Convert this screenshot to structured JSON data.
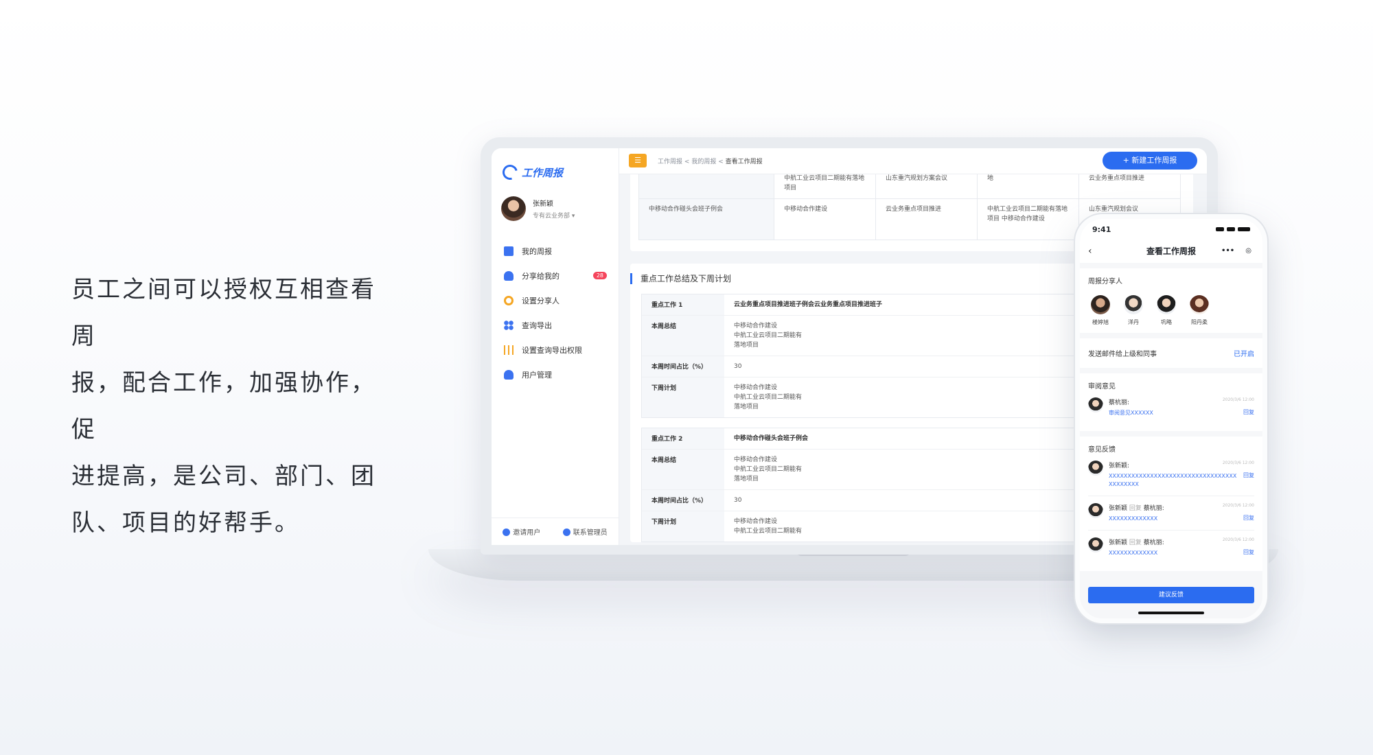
{
  "tagline": [
    "员工之间可以授权互相查看周",
    "报，配合工作，加强协作，促",
    "进提高，是公司、部门、团",
    "队、项目的好帮手。"
  ],
  "app": {
    "logo_text": "工作周报",
    "user": {
      "name": "张新颖",
      "dept": "专有云业务部 ▾"
    },
    "nav": [
      {
        "label": "我的周报",
        "icon": "book-icon"
      },
      {
        "label": "分享给我的",
        "icon": "share-icon",
        "badge": "28"
      },
      {
        "label": "设置分享人",
        "icon": "gear-icon"
      },
      {
        "label": "查询导出",
        "icon": "grid-icon"
      },
      {
        "label": "设置查询导出权限",
        "icon": "sliders-icon"
      },
      {
        "label": "用户管理",
        "icon": "user-icon"
      }
    ],
    "footer": {
      "invite": "邀请用户",
      "contact": "联系管理员"
    },
    "breadcrumb": {
      "a": "工作周报",
      "b": "我的周报",
      "current": "查看工作周报",
      "sep": "<"
    },
    "new_button": "+ 新建工作周报",
    "upper_table": [
      [
        "",
        "中航工业云项目二期能有落地项目",
        "山东重汽规划方案会议",
        "地",
        "云业务重点项目推进"
      ],
      [
        "中移动合作碰头会班子例会",
        "中移动合作建设",
        "云业务重点项目推进",
        "中航工业云项目二期能有落地项目 中移动合作建设",
        "山东重汽规划会议"
      ]
    ],
    "section_title": "重点工作总结及下周计划",
    "works": [
      {
        "title_label": "重点工作 1",
        "title": "云业务重点项目推进班子例会云业务重点项目推进班子",
        "summary_label": "本周总结",
        "summary": "中移动合作建设\n中航工业云项目二期能有\n落地项目",
        "ratio_label": "本周时间占比（%）",
        "ratio": "30",
        "plan_label": "下周计划",
        "plan": "中移动合作建设\n中航工业云项目二期能有\n落地项目"
      },
      {
        "title_label": "重点工作 2",
        "title": "中移动合作碰头会班子例会",
        "summary_label": "本周总结",
        "summary": "中移动合作建设\n中航工业云项目二期能有\n落地项目",
        "ratio_label": "本周时间占比（%）",
        "ratio": "30",
        "plan_label": "下周计划",
        "plan": "中移动合作建设\n中航工业云项目二期能有"
      }
    ]
  },
  "phone": {
    "time": "9:41",
    "title": "查看工作周报",
    "back": "‹",
    "sharers_heading": "周报分享人",
    "sharers": [
      "楼婷旭",
      "洋丹",
      "巩略",
      "阳丹柔"
    ],
    "mail_label": "发送邮件给上级和同事",
    "mail_state": "已开启",
    "review_heading": "审阅意见",
    "review": {
      "who": "蔡杭丽:",
      "text": "审阅意见XXXXXX",
      "time": "2020/3/6 12:00",
      "reply": "回复"
    },
    "feedback_heading": "意见反馈",
    "feedback": [
      {
        "who": "张新颖:",
        "rep": "",
        "to": "",
        "text": "XXXXXXXXXXXXXXXXXXXXXXXXXXXXXXXXXXXXXXXXXX",
        "time": "2020/3/6 12:00",
        "reply": "回复"
      },
      {
        "who": "张新颖",
        "rep": "回复",
        "to": "蔡杭丽:",
        "text": "XXXXXXXXXXXXX",
        "time": "2020/3/6 12:00",
        "reply": "回复"
      },
      {
        "who": "张新颖",
        "rep": "回复",
        "to": "蔡杭丽:",
        "text": "XXXXXXXXXXXXX",
        "time": "2020/3/6 12:00",
        "reply": "回复"
      }
    ],
    "suggest_button": "建议反馈"
  }
}
